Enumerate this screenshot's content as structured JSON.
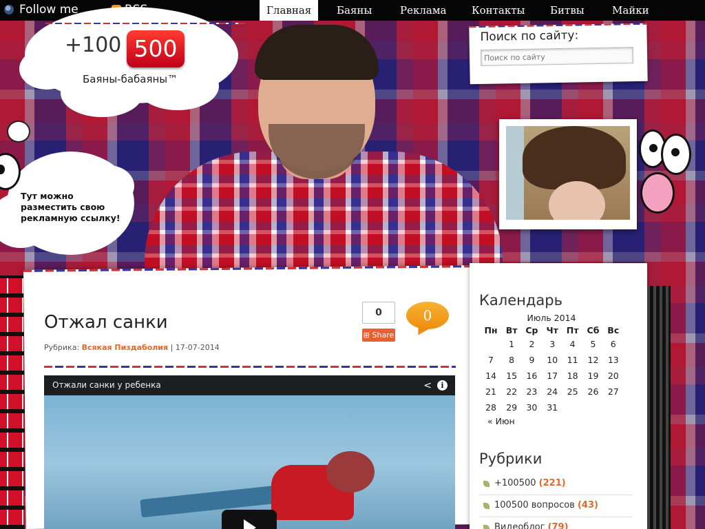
{
  "topbar": {
    "follow_label": "Follow me",
    "rss_label": "RSS",
    "nav": [
      {
        "label": "Главная",
        "active": true
      },
      {
        "label": "Баяны"
      },
      {
        "label": "Реклама"
      },
      {
        "label": "Контакты"
      },
      {
        "label": "Битвы"
      },
      {
        "label": "Майки"
      }
    ]
  },
  "logo": {
    "text": "+100",
    "badge": "500",
    "subtitle": "Баяны-бабаяны™"
  },
  "ad": {
    "line1": "Тут можно",
    "line2": "разместить свою",
    "line3": "рекламную ссылку!"
  },
  "search": {
    "title": "Поиск по сайту:",
    "placeholder": "Поиск по сайту"
  },
  "post": {
    "title": "Отжал санки",
    "meta_prefix": "Рубрика:",
    "category": "Всякая Пиздаболия",
    "separator": "|",
    "date": "17-07-2014",
    "share_count": "0",
    "share_label": "Share",
    "comment_count": "0",
    "video_title": "Отжали санки у ребенка"
  },
  "calendar": {
    "widget_title": "Календарь",
    "month": "Июль 2014",
    "weekdays": [
      "Пн",
      "Вт",
      "Ср",
      "Чт",
      "Пт",
      "Сб",
      "Вс"
    ],
    "weeks": [
      [
        "",
        "1",
        "2",
        "3",
        "4",
        "5",
        "6"
      ],
      [
        "7",
        "8",
        "9",
        "10",
        "11",
        "12",
        "13"
      ],
      [
        "14",
        "15",
        "16",
        "17",
        "18",
        "19",
        "20"
      ],
      [
        "21",
        "22",
        "23",
        "24",
        "25",
        "26",
        "27"
      ],
      [
        "28",
        "29",
        "30",
        "31",
        "",
        "",
        ""
      ]
    ],
    "prev_link": "« Июн"
  },
  "categories": {
    "widget_title": "Рубрики",
    "items": [
      {
        "label": "+100500",
        "count": "(221)"
      },
      {
        "label": "100500 вопросов",
        "count": "(43)"
      },
      {
        "label": "Видеоблог",
        "count": "(79)"
      }
    ]
  },
  "colors": {
    "accent_orange": "#e0692a",
    "logo_red": "#e2132a",
    "topbar": "#050505"
  }
}
